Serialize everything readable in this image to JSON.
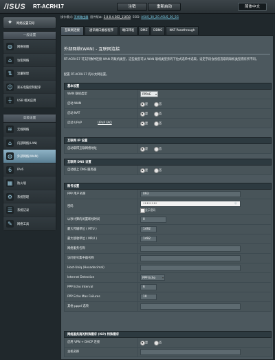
{
  "header": {
    "logo": "/ISUS",
    "model": "RT-ACRH17",
    "logout": "注销",
    "reboot": "重新启动",
    "language": "简体中文"
  },
  "status": {
    "mode_label": "操作模式:",
    "mode_value": "无线路由器",
    "fw_label": "固件版本:",
    "fw_value": "3.0.0.4.382_11810",
    "ssid_label": "SSID:",
    "ssid_value": "ASUS_30_2G  ASUS_30_5G"
  },
  "sidebar": {
    "wizard": "网络设置向导",
    "general_title": "一般设置",
    "general": [
      {
        "label": "网络地图",
        "icon": "globe-icon"
      },
      {
        "label": "访客网络",
        "icon": "guest-network-icon"
      },
      {
        "label": "流量管理",
        "icon": "traffic-icon"
      },
      {
        "label": "家长电脑控制程序",
        "icon": "parental-control-icon"
      },
      {
        "label": "USB 相关应用",
        "icon": "usb-icon"
      }
    ],
    "advanced_title": "高级设置",
    "advanced": [
      {
        "label": "无线网络",
        "icon": "wifi-icon"
      },
      {
        "label": "内部网络(LAN)",
        "icon": "lan-icon"
      },
      {
        "label": "外部网络(WAN)",
        "icon": "wan-icon"
      },
      {
        "label": "IPv6",
        "icon": "ipv6-icon"
      },
      {
        "label": "防火墙",
        "icon": "firewall-icon"
      },
      {
        "label": "系统管理",
        "icon": "admin-icon"
      },
      {
        "label": "系统记录",
        "icon": "log-icon"
      },
      {
        "label": "网络工具",
        "icon": "tools-icon"
      }
    ]
  },
  "tabs": [
    "互联网连接",
    "通讯端口触发程序",
    "端口转发",
    "DMZ",
    "DDNS",
    "NAT Passthrough"
  ],
  "page": {
    "title": "外部网络(WAN) - 互联网连接",
    "description": "RT-ACRH17 可支持数种连接 WAN 的联机类型。这些类型可从 WAN 联机类型旁的下拉式选单中选取。设定字段会视您选取的联机类型而有所不同。",
    "configure": "配置 RT-ACRH17 的以太网设置。"
  },
  "basic": {
    "title": "基本设置",
    "wan_type_label": "WAN 联机类型",
    "wan_type_value": "PPPoE",
    "enable_wan_label": "启动 WAN",
    "enable_nat_label": "启动 NAT",
    "enable_upnp_label": "启动 UPnP",
    "upnp_faq": "UPnP  FAQ",
    "yes": "是",
    "no": "否"
  },
  "wan_ip": {
    "title": "互联网 IP 设置",
    "auto_ip_label": "自动取得互联网络地址"
  },
  "wan_dns": {
    "title": "互联网 DNS 设置",
    "auto_dns_label": "自动接上 DNS 服务器"
  },
  "account": {
    "title": "账号设置",
    "username_label": "PPP 用户名称",
    "username_value": "093",
    "password_label": "密码",
    "password_value": "••••••••",
    "show_password": "显示密码",
    "idle_label": "以秒计算的闲置断线时间",
    "idle_value": "0",
    "mtu_label": "最大传输单位 ( MTU )",
    "mtu_value": "1492",
    "mru_label": "最大接收单位 ( MRU )",
    "mru_value": "1492",
    "service_label": "网络服务名称",
    "ac_label": "访问组号集中器名称",
    "hostuniq_label": "Host-Uniq (Hexadecimal)",
    "detection_label": "Internet Detection",
    "detection_value": "PPP Echo",
    "echo_interval_label": "PPP Echo Interval",
    "echo_interval_value": "6",
    "echo_max_label": "PPP Echo Max Failures",
    "echo_max_value": "10",
    "extra_label": "其他 pppd 选项"
  },
  "isp": {
    "title": "网络服务商的特殊需求 (ISP) 特殊需求",
    "vpn_dhcp_label": "启用 VPN + DHCP 连接",
    "hostname_label": "主机名称"
  }
}
